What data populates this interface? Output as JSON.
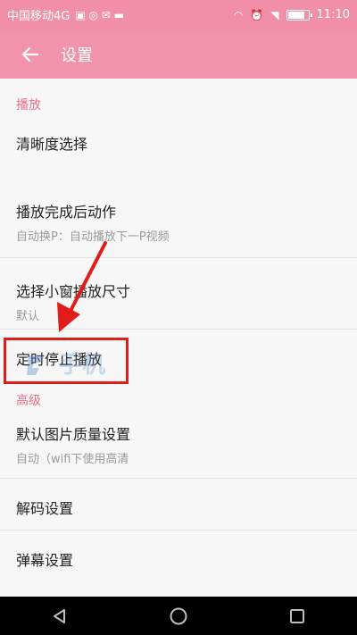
{
  "status_bar": {
    "carrier": "中国移动4G",
    "time": "11:10"
  },
  "app_bar": {
    "title": "设置"
  },
  "sections": [
    {
      "header": "播放",
      "items": [
        {
          "title": "清晰度选择",
          "subtitle": ""
        },
        {
          "title": "播放完成后动作",
          "subtitle": "自动换P：自动播放下一P视频"
        },
        {
          "title": "选择小窗播放尺寸",
          "subtitle": "默认"
        },
        {
          "title": "定时停止播放",
          "subtitle": ""
        }
      ]
    },
    {
      "header": "高级",
      "items": [
        {
          "title": "默认图片质量设置",
          "subtitle": "自动（wifi下使用高清"
        },
        {
          "title": "解码设置",
          "subtitle": ""
        },
        {
          "title": "弹幕设置",
          "subtitle": ""
        }
      ]
    }
  ],
  "watermark_text": "手机",
  "colors": {
    "accent": "#f293ad",
    "section_header": "#ea6f8d",
    "highlight": "#e21b1b"
  },
  "icons": {
    "back": "arrow-left-icon",
    "nav_back": "triangle-back-icon",
    "nav_home": "circle-home-icon",
    "nav_recent": "square-recent-icon"
  }
}
